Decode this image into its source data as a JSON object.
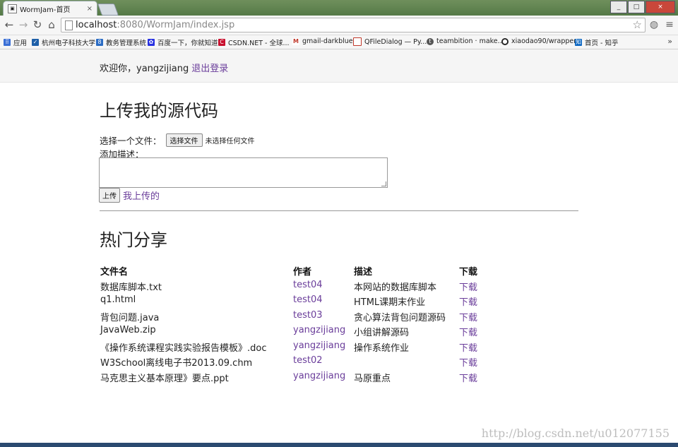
{
  "browser": {
    "tab_title": "WormJam-首页",
    "tab_close": "×",
    "url_host": "localhost",
    "url_path": ":8080/WormJam/index.jsp",
    "window_buttons": [
      "_",
      "□",
      "×"
    ],
    "bookmarks": [
      {
        "label": "应用",
        "icon": "apps-grid-icon",
        "color": "#3a6fd6"
      },
      {
        "label": "杭州电子科技大学",
        "icon": "hdu-icon",
        "color": "#1e5fa8"
      },
      {
        "label": "教务管理系统",
        "icon": "system-icon",
        "color": "#2b6cc4"
      },
      {
        "label": "百度一下，你就知道",
        "icon": "baidu-paw-icon",
        "color": "#2932e1"
      },
      {
        "label": "CSDN.NET - 全球...",
        "icon": "csdn-icon",
        "color": "#c8102e"
      },
      {
        "label": "gmail-darkblue",
        "icon": "gmail-icon",
        "color": "#c0392b"
      },
      {
        "label": "QFileDialog — Py...",
        "icon": "doc-icon",
        "color": "#c0392b"
      },
      {
        "label": "teambition · make...",
        "icon": "teambition-icon",
        "color": "#555555"
      },
      {
        "label": "xiaodao90/wrapper",
        "icon": "github-icon",
        "color": "#222222"
      },
      {
        "label": "首页 - 知乎",
        "icon": "zhihu-icon",
        "color": "#0a66c2"
      }
    ],
    "bookmarks_more": "»"
  },
  "header": {
    "welcome_text": "欢迎你，yangzijiang",
    "logout_label": "退出登录"
  },
  "upload": {
    "title": "上传我的源代码",
    "choose_label": "选择一个文件：",
    "choose_button": "选择文件",
    "no_file_text": "未选择任何文件",
    "description_label": "添加描述：",
    "submit_label": "上传",
    "my_uploads_label": "我上传的"
  },
  "hot": {
    "title": "热门分享",
    "columns": [
      "文件名",
      "作者",
      "描述",
      "下载"
    ],
    "rows": [
      {
        "file": "数据库脚本.txt",
        "author": "test04",
        "desc": "本网站的数据库脚本",
        "download": "下载"
      },
      {
        "file": "q1.html",
        "author": "test04",
        "desc": "HTML课期末作业",
        "download": "下载"
      },
      {
        "file": "背包问题.java",
        "author": "test03",
        "desc": "贪心算法背包问题源码",
        "download": "下载"
      },
      {
        "file": "JavaWeb.zip",
        "author": "yangzijiang",
        "desc": "小组讲解源码",
        "download": "下载"
      },
      {
        "file": "《操作系统课程实践实验报告模板》.doc",
        "author": "yangzijiang",
        "desc": "操作系统作业",
        "download": "下载"
      },
      {
        "file": "W3School离线电子书2013.09.chm",
        "author": "test02",
        "desc": "",
        "download": "下载"
      },
      {
        "file": "马克思主义基本原理》要点.ppt",
        "author": "yangzijiang",
        "desc": "马原重点",
        "download": "下载"
      }
    ]
  },
  "watermark": "http://blog.csdn.net/u012077155",
  "colors": {
    "link": "#6a3d9a",
    "text": "#222222"
  }
}
